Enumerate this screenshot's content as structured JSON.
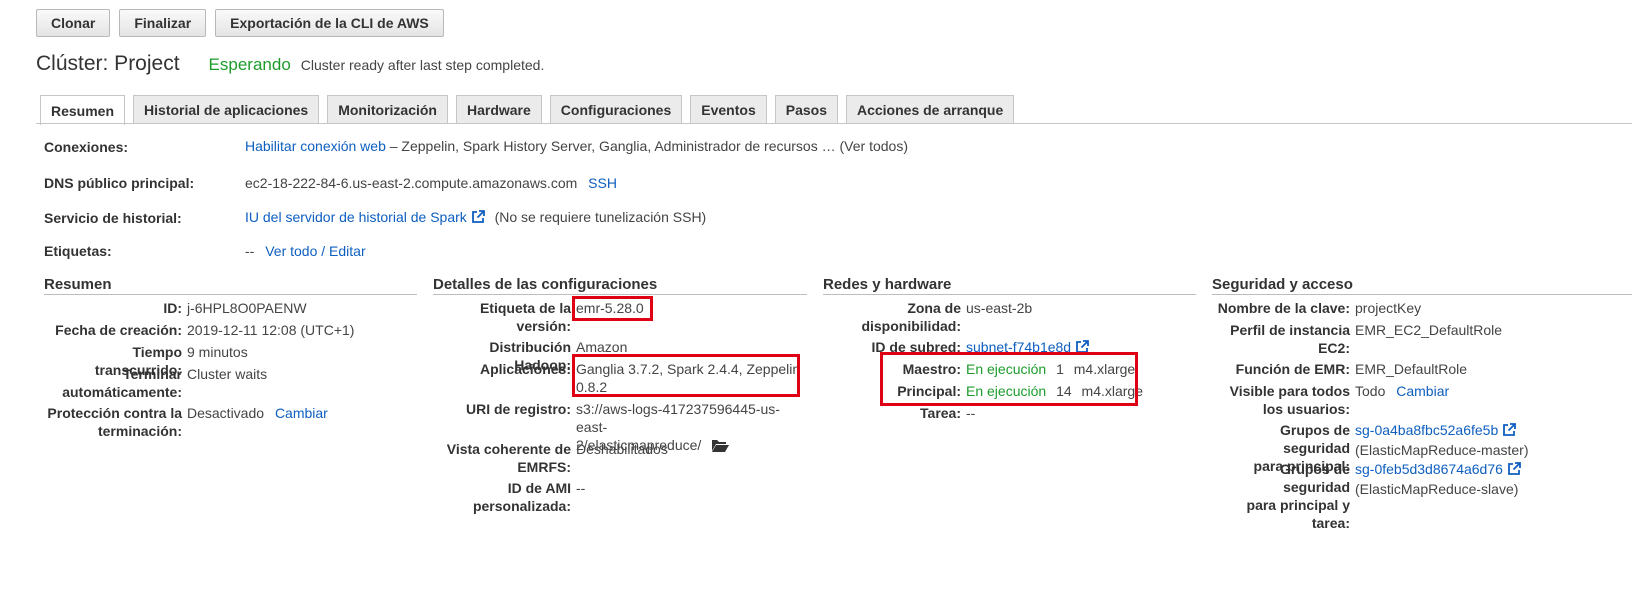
{
  "toolbar": {
    "clone": "Clonar",
    "terminate": "Finalizar",
    "cli_export": "Exportación de la CLI de AWS"
  },
  "header": {
    "title": "Clúster: Project",
    "status": "Esperando",
    "status_message": "Cluster ready after last step completed."
  },
  "tabs": [
    "Resumen",
    "Historial de aplicaciones",
    "Monitorización",
    "Hardware",
    "Configuraciones",
    "Eventos",
    "Pasos",
    "Acciones de arranque"
  ],
  "connections": {
    "label": "Conexiones:",
    "link": "Habilitar conexión web",
    "text": "– Zeppelin, Spark History Server, Ganglia, Administrador de recursos … (Ver todos)"
  },
  "dns": {
    "label": "DNS público principal:",
    "value": "ec2-18-222-84-6.us-east-2.compute.amazonaws.com",
    "ssh": "SSH"
  },
  "history": {
    "label": "Servicio de historial:",
    "link": "IU del servidor de historial de Spark",
    "note": "(No se requiere tunelización SSH)"
  },
  "tags": {
    "label": "Etiquetas:",
    "value": "--",
    "link": "Ver todo / Editar"
  },
  "summary": {
    "title": "Resumen",
    "id_label": "ID:",
    "id": "j-6HPL8O0PAENW",
    "created_label": "Fecha de creación:",
    "created": "2019-12-11 12:08 (UTC+1)",
    "elapsed_label": "Tiempo transcurrido:",
    "elapsed": "9 minutos",
    "autoterm_label1": "Terminar",
    "autoterm_label2": "automáticamente:",
    "autoterm": "Cluster waits",
    "protection_label1": "Protección contra la",
    "protection_label2": "terminación:",
    "protection": "Desactivado",
    "protection_change": "Cambiar"
  },
  "config": {
    "title": "Detalles de las configuraciones",
    "release_label1": "Etiqueta de la",
    "release_label2": "versión:",
    "release": "emr-5.28.0",
    "hadoop_label": "Distribución Hadoop:",
    "hadoop": "Amazon",
    "apps_label": "Aplicaciones:",
    "apps1": "Ganglia 3.7.2, Spark 2.4.4, Zeppelin",
    "apps2": "0.8.2",
    "log_label": "URI de registro:",
    "log1": "s3://aws-logs-417237596445-us-east-",
    "log2": "2/elasticmapreduce/",
    "emrfs_label1": "Vista coherente de",
    "emrfs_label2": "EMRFS:",
    "emrfs": "Deshabilitados",
    "ami_label1": "ID de AMI",
    "ami_label2": "personalizada:",
    "ami": "--"
  },
  "network": {
    "title": "Redes y hardware",
    "az_label1": "Zona de",
    "az_label2": "disponibilidad:",
    "az": "us-east-2b",
    "subnet_label": "ID de subred:",
    "subnet": "subnet-f74b1e8d",
    "master_label": "Maestro:",
    "master_state": "En ejecución",
    "master_count": "1",
    "master_type": "m4.xlarge",
    "core_label": "Principal:",
    "core_state": "En ejecución",
    "core_count": "14",
    "core_type": "m4.xlarge",
    "task_label": "Tarea:",
    "task": "--"
  },
  "security": {
    "title": "Seguridad y acceso",
    "key_label": "Nombre de la clave:",
    "key": "projectKey",
    "profile_label1": "Perfil de instancia",
    "profile_label2": "EC2:",
    "profile": "EMR_EC2_DefaultRole",
    "role_label": "Función de EMR:",
    "role": "EMR_DefaultRole",
    "visible_label1": "Visible para todos",
    "visible_label2": "los usuarios:",
    "visible": "Todo",
    "visible_change": "Cambiar",
    "sg_master_label1": "Grupos de seguridad",
    "sg_master_label2": "para principal:",
    "sg_master": "sg-0a4ba8fbc52a6fe5b",
    "sg_master_name": "(ElasticMapReduce-master)",
    "sg_slave_label1": "Grupos de seguridad",
    "sg_slave_label2": "para principal y",
    "sg_slave_label3": "tarea:",
    "sg_slave": "sg-0feb5d3d8674a6d76",
    "sg_slave_name": "(ElasticMapReduce-slave)"
  }
}
